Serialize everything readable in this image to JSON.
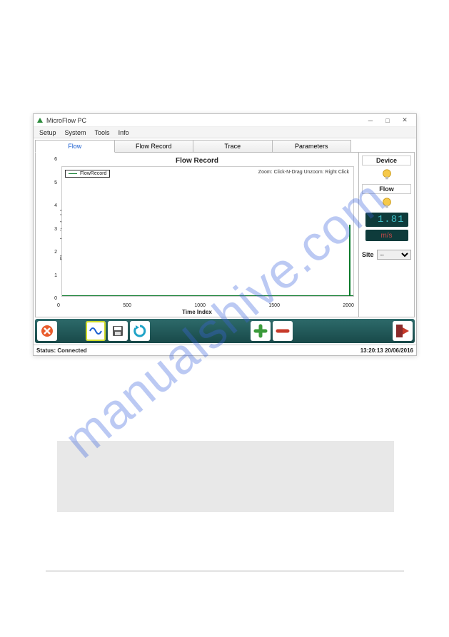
{
  "watermark": "manualshive.com",
  "window": {
    "title": "MicroFlow PC",
    "menus": [
      "Setup",
      "System",
      "Tools",
      "Info"
    ],
    "tabs": [
      "Flow",
      "Flow Record",
      "Trace",
      "Parameters"
    ],
    "active_tab": 0
  },
  "sidebar": {
    "device_label": "Device",
    "flow_label": "Flow",
    "flow_value": "1.81",
    "flow_unit": "m/s",
    "site_label": "Site",
    "site_value": "--"
  },
  "chart_data": {
    "type": "line",
    "title": "Flow Record",
    "xlabel": "Time Index",
    "ylabel": "Flow velocity (m/s)",
    "xlim": [
      0,
      2000
    ],
    "ylim": [
      0,
      6
    ],
    "xticks": [
      0,
      500,
      1000,
      1500,
      2000
    ],
    "yticks": [
      0,
      1,
      2,
      3,
      4,
      5,
      6
    ],
    "legend": [
      "FlowRecord"
    ],
    "zoom_hint": "Zoom: Click-N-Drag   Unzoom: Right Click",
    "series": [
      {
        "name": "FlowRecord",
        "x": [
          0,
          1980,
          1985,
          1990,
          2000
        ],
        "values": [
          0,
          0,
          3.5,
          1.0,
          1.8
        ]
      }
    ]
  },
  "toolbar": {
    "buttons": [
      "cancel",
      "wave",
      "save",
      "refresh",
      "plus",
      "minus",
      "exit"
    ]
  },
  "status": {
    "text": "Status: Connected",
    "timestamp": "13:20:13 20/06/2016"
  }
}
